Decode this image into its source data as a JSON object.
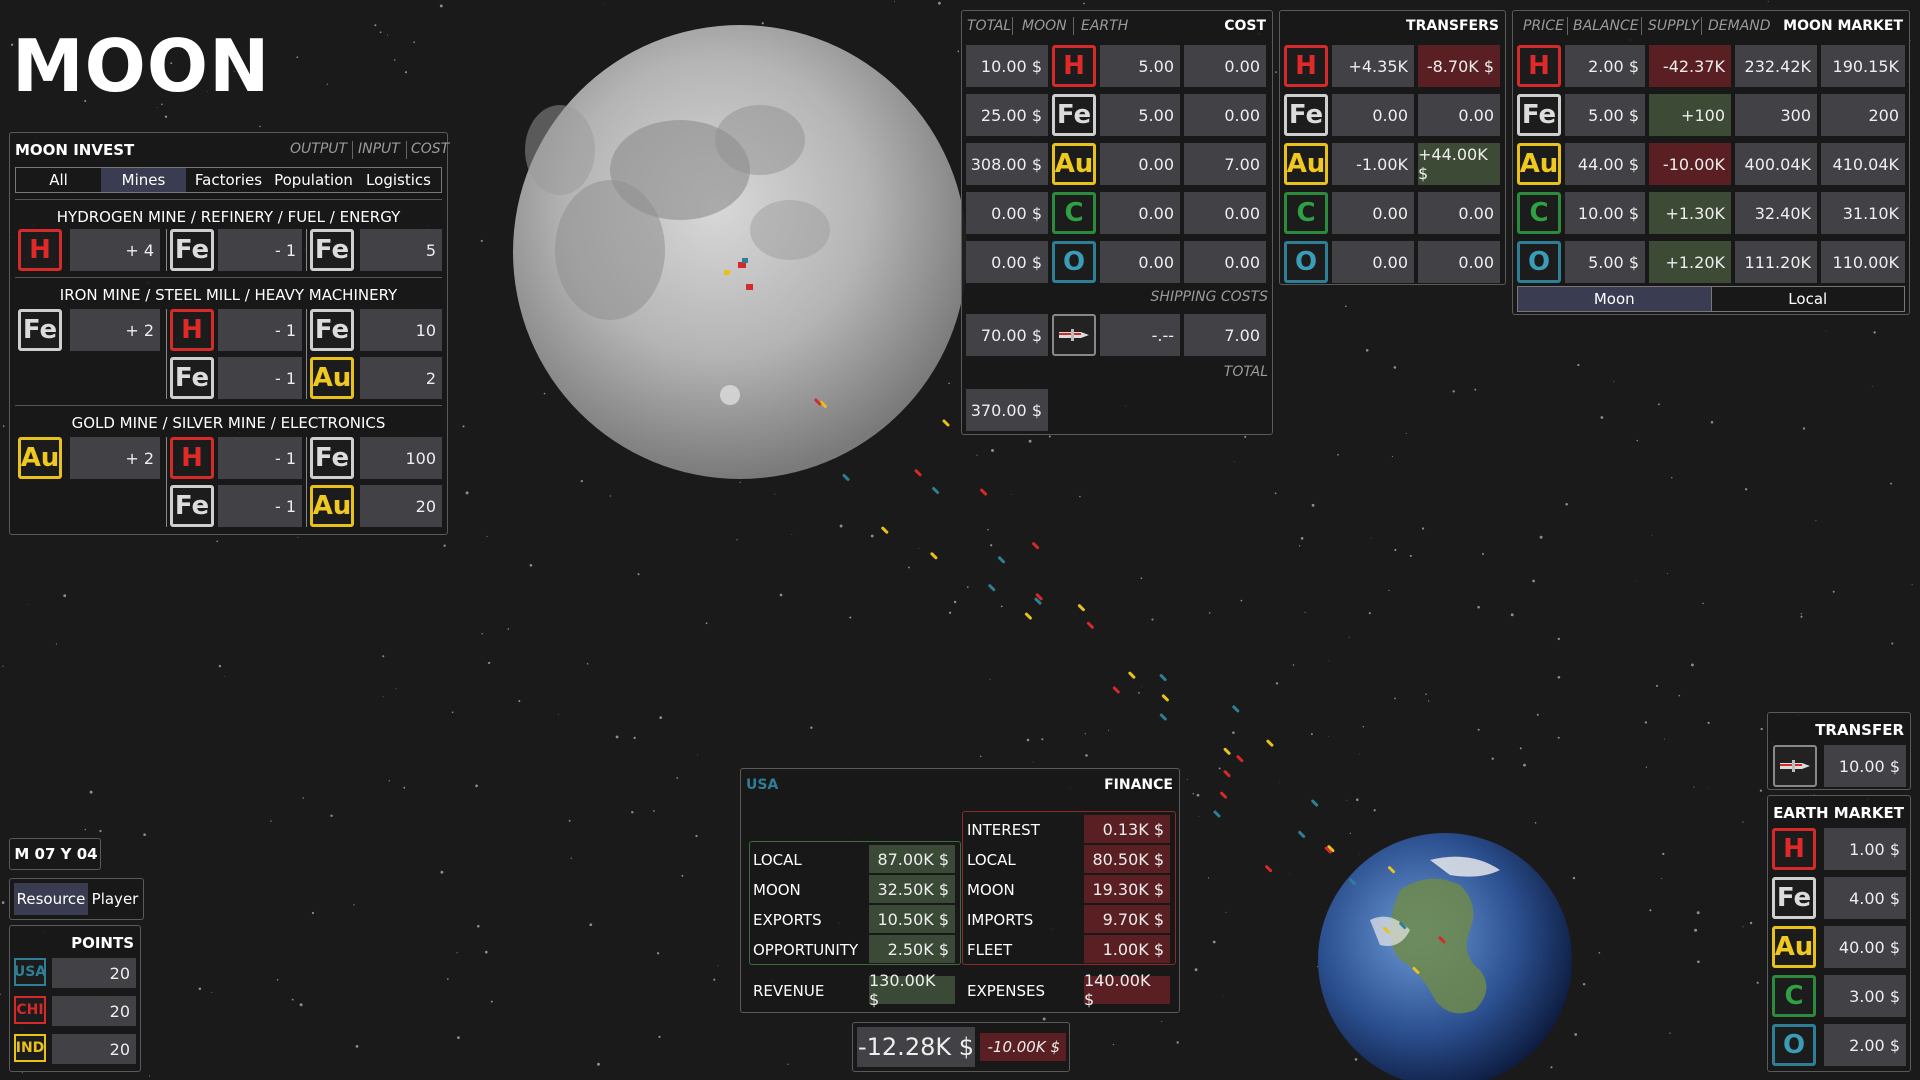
{
  "title": "MOON",
  "invest": {
    "title": "MOON INVEST",
    "headers": [
      "OUTPUT",
      "INPUT",
      "COST"
    ],
    "tabs": [
      "All",
      "Mines",
      "Factories",
      "Population",
      "Logistics"
    ],
    "active_tab": "Mines",
    "sections": [
      {
        "title": "HYDROGEN MINE / REFINERY / FUEL / ENERGY",
        "output": {
          "el": "H",
          "amt": "+ 4"
        },
        "inputs": [
          {
            "el": "Fe",
            "amt": "- 1"
          }
        ],
        "costs": [
          {
            "el": "Fe",
            "amt": "5"
          }
        ]
      },
      {
        "title": "IRON MINE / STEEL MILL / HEAVY MACHINERY",
        "output": {
          "el": "Fe",
          "amt": "+ 2"
        },
        "inputs": [
          {
            "el": "H",
            "amt": "- 1"
          },
          {
            "el": "Fe",
            "amt": "- 1"
          }
        ],
        "costs": [
          {
            "el": "Fe",
            "amt": "10"
          },
          {
            "el": "Au",
            "amt": "2"
          }
        ]
      },
      {
        "title": "GOLD MINE / SILVER MINE / ELECTRONICS",
        "output": {
          "el": "Au",
          "amt": "+ 2"
        },
        "inputs": [
          {
            "el": "H",
            "amt": "- 1"
          },
          {
            "el": "Fe",
            "amt": "- 1"
          }
        ],
        "costs": [
          {
            "el": "Fe",
            "amt": "100"
          },
          {
            "el": "Au",
            "amt": "20"
          }
        ]
      }
    ]
  },
  "cost_panel": {
    "headers": [
      "TOTAL",
      "MOON",
      "EARTH"
    ],
    "title": "COST",
    "rows": [
      {
        "total": "10.00 $",
        "el": "H",
        "moon": "5.00",
        "earth": "0.00"
      },
      {
        "total": "25.00 $",
        "el": "Fe",
        "moon": "5.00",
        "earth": "0.00"
      },
      {
        "total": "308.00 $",
        "el": "Au",
        "moon": "0.00",
        "earth": "7.00"
      },
      {
        "total": "0.00 $",
        "el": "C",
        "moon": "0.00",
        "earth": "0.00"
      },
      {
        "total": "0.00 $",
        "el": "O",
        "moon": "0.00",
        "earth": "0.00"
      }
    ],
    "shipping_label": "SHIPPING COSTS",
    "shipping": {
      "total": "70.00 $",
      "moon": "-.--",
      "earth": "7.00"
    },
    "total_label": "TOTAL",
    "total": "370.00 $"
  },
  "transfers": {
    "title": "TRANSFERS",
    "rows": [
      {
        "el": "H",
        "a": "+4.35K",
        "b": "-8.70K $",
        "b_style": "red"
      },
      {
        "el": "Fe",
        "a": "0.00",
        "b": "0.00",
        "b_style": ""
      },
      {
        "el": "Au",
        "a": "-1.00K",
        "b": "+44.00K $",
        "b_style": "green"
      },
      {
        "el": "C",
        "a": "0.00",
        "b": "0.00",
        "b_style": ""
      },
      {
        "el": "O",
        "a": "0.00",
        "b": "0.00",
        "b_style": ""
      }
    ]
  },
  "moon_market": {
    "headers": [
      "PRICE",
      "BALANCE",
      "SUPPLY",
      "DEMAND"
    ],
    "title": "MOON MARKET",
    "rows": [
      {
        "el": "H",
        "price": "2.00 $",
        "balance": "-42.37K",
        "b_style": "red",
        "supply": "232.42K",
        "demand": "190.15K"
      },
      {
        "el": "Fe",
        "price": "5.00 $",
        "balance": "+100",
        "b_style": "green",
        "supply": "300",
        "demand": "200"
      },
      {
        "el": "Au",
        "price": "44.00 $",
        "balance": "-10.00K",
        "b_style": "red",
        "supply": "400.04K",
        "demand": "410.04K"
      },
      {
        "el": "C",
        "price": "10.00 $",
        "balance": "+1.30K",
        "b_style": "green",
        "supply": "32.40K",
        "demand": "31.10K"
      },
      {
        "el": "O",
        "price": "5.00 $",
        "balance": "+1.20K",
        "b_style": "green",
        "supply": "111.20K",
        "demand": "110.00K"
      }
    ],
    "tabs": [
      "Moon",
      "Local"
    ],
    "active_tab": "Moon"
  },
  "finance": {
    "country": "USA",
    "title": "FINANCE",
    "income": [
      {
        "label": "LOCAL",
        "value": "87.00K $"
      },
      {
        "label": "MOON",
        "value": "32.50K $"
      },
      {
        "label": "EXPORTS",
        "value": "10.50K $"
      },
      {
        "label": "OPPORTUNITY",
        "value": "2.50K $"
      }
    ],
    "expenses": [
      {
        "label": "INTEREST",
        "value": "0.13K $"
      },
      {
        "label": "LOCAL",
        "value": "80.50K $"
      },
      {
        "label": "MOON",
        "value": "19.30K $"
      },
      {
        "label": "IMPORTS",
        "value": "9.70K $"
      },
      {
        "label": "FLEET",
        "value": "1.00K $"
      }
    ],
    "revenue_label": "REVENUE",
    "revenue": "130.00K $",
    "expenses_label": "EXPENSES",
    "expenses_total": "140.00K $",
    "balance": "-12.28K $",
    "delta": "-10.00K $"
  },
  "date": "M 07 Y 04",
  "view_tabs": [
    "Resource",
    "Player"
  ],
  "active_view": "Resource",
  "points": {
    "title": "POINTS",
    "rows": [
      {
        "country": "USA",
        "value": "20",
        "color": "#2e7f96"
      },
      {
        "country": "CHI",
        "value": "20",
        "color": "#d42a2a"
      },
      {
        "country": "IND",
        "value": "20",
        "color": "#e8c21a"
      }
    ]
  },
  "transfer": {
    "title": "TRANSFER",
    "value": "10.00 $"
  },
  "earth_market": {
    "title": "EARTH MARKET",
    "rows": [
      {
        "el": "H",
        "price": "1.00 $"
      },
      {
        "el": "Fe",
        "price": "4.00 $"
      },
      {
        "el": "Au",
        "price": "40.00 $"
      },
      {
        "el": "C",
        "price": "3.00 $"
      },
      {
        "el": "O",
        "price": "2.00 $"
      }
    ]
  }
}
